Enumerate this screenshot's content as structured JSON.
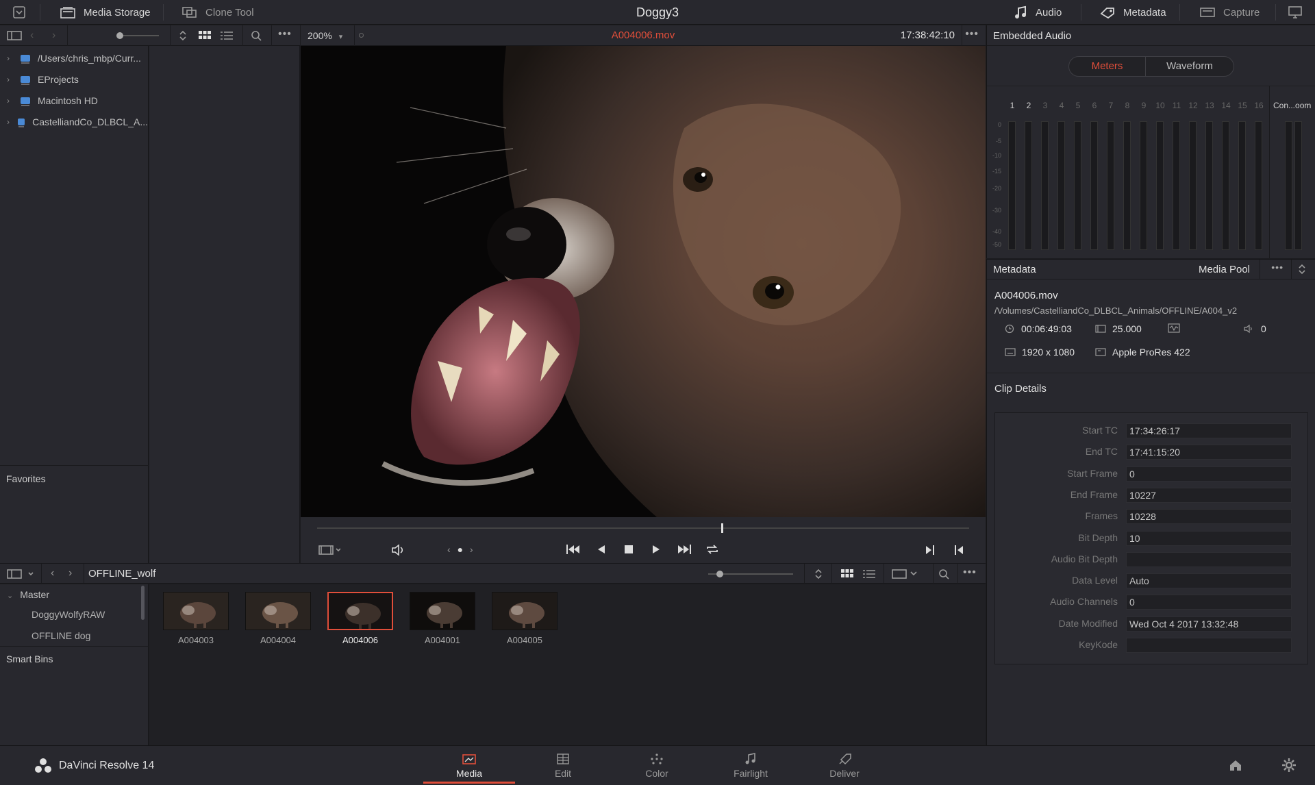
{
  "topbar": {
    "media_storage": "Media Storage",
    "clone_tool": "Clone Tool",
    "project_title": "Doggy3",
    "audio": "Audio",
    "metadata": "Metadata",
    "capture": "Capture"
  },
  "storage": {
    "items": [
      {
        "label": "/Users/chris_mbp/Curr..."
      },
      {
        "label": "EProjects"
      },
      {
        "label": "Macintosh HD"
      },
      {
        "label": "CastelliandCo_DLBCL_A..."
      }
    ],
    "favorites": "Favorites"
  },
  "viewer": {
    "zoom": "200%",
    "clip_name": "A004006.mov",
    "timecode": "17:38:42:10",
    "playhead_position": 0.62
  },
  "bins": {
    "path": "OFFLINE_wolf",
    "master": "Master",
    "children": [
      "DoggyWolfyRAW",
      "OFFLINE dog"
    ],
    "smart_bins": "Smart Bins"
  },
  "clips": [
    {
      "name": "A004003",
      "selected": false
    },
    {
      "name": "A004004",
      "selected": false
    },
    {
      "name": "A004006",
      "selected": true
    },
    {
      "name": "A004001",
      "selected": false
    },
    {
      "name": "A004005",
      "selected": false
    }
  ],
  "audio_panel": {
    "title": "Embedded Audio",
    "tab_meters": "Meters",
    "tab_waveform": "Waveform",
    "channels": [
      "1",
      "2",
      "3",
      "4",
      "5",
      "6",
      "7",
      "8",
      "9",
      "10",
      "11",
      "12",
      "13",
      "14",
      "15",
      "16"
    ],
    "control_room": "Con...oom",
    "scale": [
      "0",
      "-5",
      "-10",
      "-15",
      "-20",
      "-30",
      "-40",
      "-50"
    ]
  },
  "metadata_panel": {
    "title": "Metadata",
    "source": "Media Pool",
    "file_name": "A004006.mov",
    "file_path": "/Volumes/CastelliandCo_DLBCL_Animals/OFFLINE/A004_v2",
    "duration": "00:06:49:03",
    "fps": "25.000",
    "audio_channels_short": "0",
    "resolution": "1920 x 1080",
    "codec": "Apple ProRes 422",
    "section_title": "Clip Details",
    "fields": [
      {
        "label": "Start TC",
        "value": "17:34:26:17"
      },
      {
        "label": "End TC",
        "value": "17:41:15:20"
      },
      {
        "label": "Start Frame",
        "value": "0"
      },
      {
        "label": "End Frame",
        "value": "10227"
      },
      {
        "label": "Frames",
        "value": "10228"
      },
      {
        "label": "Bit Depth",
        "value": "10"
      },
      {
        "label": "Audio Bit Depth",
        "value": ""
      },
      {
        "label": "Data Level",
        "value": "Auto"
      },
      {
        "label": "Audio Channels",
        "value": "0"
      },
      {
        "label": "Date Modified",
        "value": "Wed Oct 4 2017 13:32:48"
      },
      {
        "label": "KeyKode",
        "value": ""
      }
    ]
  },
  "footer": {
    "app_name": "DaVinci Resolve 14",
    "pages": [
      {
        "label": "Media",
        "active": true
      },
      {
        "label": "Edit",
        "active": false
      },
      {
        "label": "Color",
        "active": false
      },
      {
        "label": "Fairlight",
        "active": false
      },
      {
        "label": "Deliver",
        "active": false
      }
    ]
  },
  "colors": {
    "accent": "#e04e3a",
    "panel": "#28282e",
    "background": "#1c1c1f"
  }
}
